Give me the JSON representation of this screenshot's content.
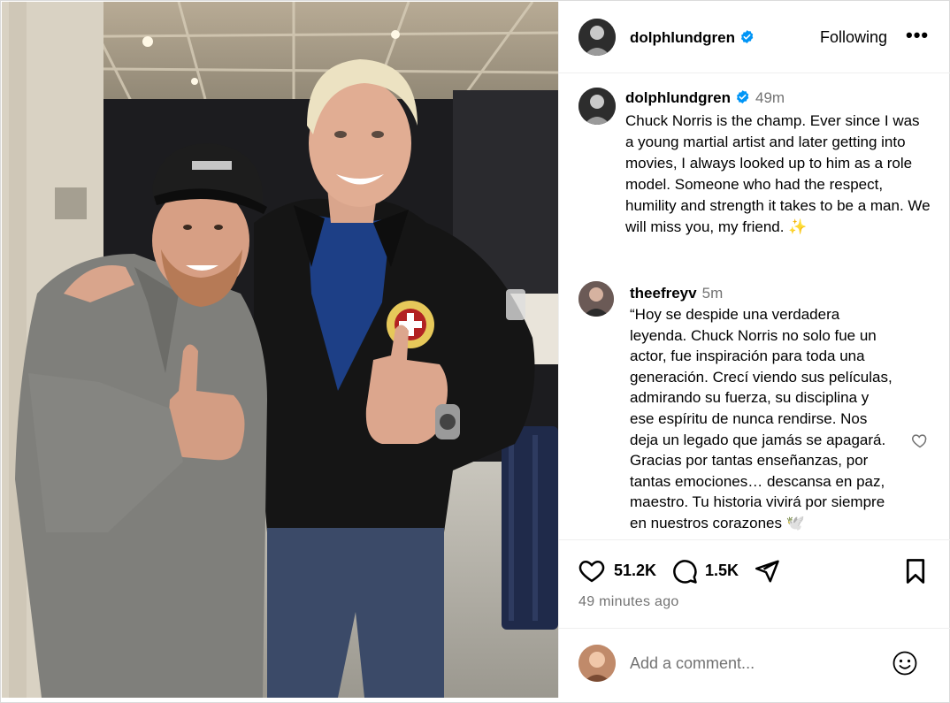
{
  "post": {
    "username": "dolphlundgren",
    "follow_state": "Following",
    "more_label": "•••",
    "caption": {
      "username": "dolphlundgren",
      "time": "49m",
      "text": "Chuck Norris is the champ. Ever since I was a young martial artist and later getting into movies, I always looked up to him as a role model. Someone who had the respect, humility and strength it takes to be a man. We will miss you, my friend.",
      "emoji": "✨"
    },
    "comments": [
      {
        "username": "theefreyv",
        "time": "5m",
        "text": "“Hoy se despide una verdadera leyenda. Chuck Norris no solo fue un actor, fue inspiración para toda una generación. Crecí viendo sus películas, admirando su fuerza, su disciplina y ese espíritu de nunca rendirse. Nos deja un legado que jamás se apagará. Gracias por tantas enseñanzas, por tantas emociones… descansa en paz, maestro. Tu historia vivirá por siempre en nuestros corazones 🕊️"
      }
    ],
    "likes": "51.2K",
    "comment_count": "1.5K",
    "posted_ago": "49 minutes ago",
    "add_comment_placeholder": "Add a comment..."
  },
  "icons": {
    "verified": "verified-badge-icon",
    "like": "heart-icon",
    "comment": "speech-bubble-icon",
    "share": "paper-plane-icon",
    "save": "bookmark-icon",
    "emoji": "smiley-icon",
    "more": "ellipsis-icon"
  },
  "colors": {
    "verified_blue": "#0095f6",
    "secondary_text": "#737373",
    "divider": "#efefef"
  }
}
